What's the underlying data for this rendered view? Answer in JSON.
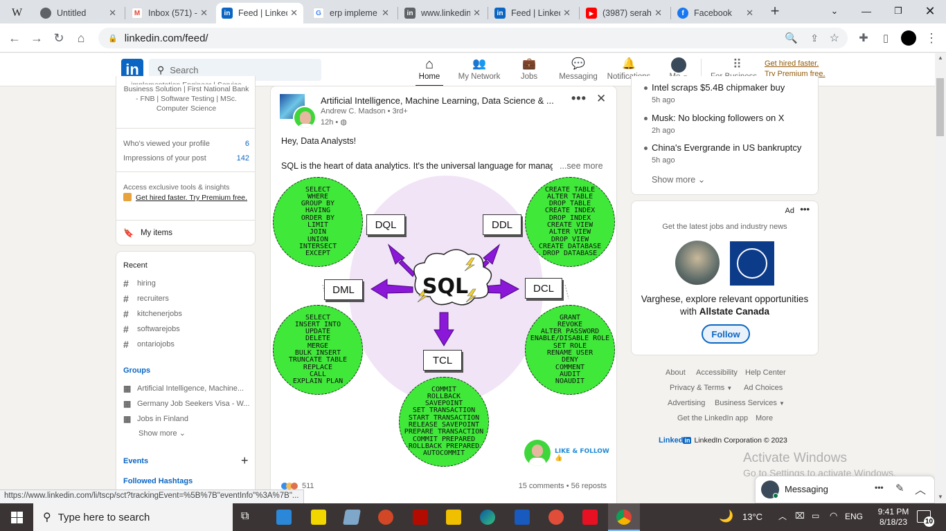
{
  "browser": {
    "tabs": [
      {
        "label": "W",
        "title": "",
        "fav": "W",
        "color": "#ffffff",
        "fgc": "#222"
      },
      {
        "label": "Untitled",
        "title": "Untitled",
        "fav": "◉",
        "color": "#5f6368"
      },
      {
        "label": "Inbox (571) -",
        "title": "Inbox (571) -",
        "fav": "M",
        "color": "#ea4335"
      },
      {
        "label": "Feed | Linked",
        "title": "Feed | Linked",
        "fav": "in",
        "color": "#0a66c2"
      },
      {
        "label": "erp impleme",
        "title": "erp impleme",
        "fav": "G",
        "color": "#4285f4"
      },
      {
        "label": "www.linkedin",
        "title": "www.linkedin",
        "fav": "in",
        "color": "#0a66c2"
      },
      {
        "label": "Feed | Linked",
        "title": "Feed | Linked",
        "fav": "in",
        "color": "#0a66c2"
      },
      {
        "label": "(3987) serah",
        "title": "(3987) serah",
        "fav": "▶",
        "color": "#ff0000"
      },
      {
        "label": "Facebook",
        "title": "Facebook",
        "fav": "f",
        "color": "#1877f2"
      }
    ],
    "url": "linkedin.com/feed/",
    "status_url": "https://www.linkedin.com/li/tscp/sct?trackingEvent=%5B%7B\"eventInfo\"%3A%7B\"..."
  },
  "header": {
    "search_placeholder": "Search",
    "nav": [
      {
        "label": "Home",
        "icon": "home-icon",
        "glyph": "⌂"
      },
      {
        "label": "My Network",
        "icon": "network-icon",
        "glyph": "👥"
      },
      {
        "label": "Jobs",
        "icon": "briefcase-icon",
        "glyph": "💼"
      },
      {
        "label": "Messaging",
        "icon": "messaging-icon",
        "glyph": "💬"
      },
      {
        "label": "Notifications",
        "icon": "bell-icon",
        "glyph": "🔔"
      }
    ],
    "me_label": "Me",
    "for_business": "For Business",
    "premium_line1": "Get hired faster.",
    "premium_line2": "Try Premium free."
  },
  "left": {
    "profile_headline": "Business Solution | First National Bank - FNB | Software Testing | MSc. Computer Science",
    "profile_headline_top": "implementation Engineer | Service",
    "stats": [
      {
        "label": "Who's viewed your profile",
        "value": "6"
      },
      {
        "label": "Impressions of your post",
        "value": "142"
      }
    ],
    "access_text": "Access exclusive tools & insights",
    "premium_text": "Get hired faster. Try Premium free.",
    "my_items": "My items",
    "recent_title": "Recent",
    "recent": [
      "hiring",
      "recruiters",
      "kitchenerjobs",
      "softwarejobs",
      "ontariojobs"
    ],
    "groups_title": "Groups",
    "groups": [
      "Artificial Intelligence, Machine...",
      "Germany Job Seekers Visa - W...",
      "Jobs in Finland"
    ],
    "show_more": "Show more",
    "events": "Events",
    "followed_hashtags": "Followed Hashtags"
  },
  "post": {
    "group": "Artificial Intelligence, Machine Learning, Data Science & ...",
    "author": "Andrew C. Madson • 3rd+",
    "time": "12h •",
    "greeting": "Hey, Data Analysts!",
    "body": "SQL is the heart of data analytics. It's the universal language for managi",
    "see_more": "...see more",
    "center_label": "SQL",
    "boxes": {
      "dql": "DQL",
      "ddl": "DDL",
      "dml": "DML",
      "dcl": "DCL",
      "tcl": "TCL"
    },
    "dql_cmds": [
      "SELECT",
      "WHERE",
      "GROUP BY",
      "HAVING",
      "ORDER BY",
      "LIMIT",
      "JOIN",
      "UNION",
      "INTERSECT",
      "EXCEPT"
    ],
    "ddl_cmds": [
      "CREATE TABLE",
      "ALTER TABLE",
      "DROP TABLE",
      "CREATE INDEX",
      "DROP INDEX",
      "CREATE VIEW",
      "ALTER VIEW",
      "DROP VIEW",
      "CREATE DATABASE",
      "DROP DATABASE"
    ],
    "dml_cmds": [
      "SELECT",
      "INSERT INTO",
      "UPDATE",
      "DELETE",
      "MERGE",
      "BULK INSERT",
      "TRUNCATE TABLE",
      "REPLACE",
      "CALL",
      "EXPLAIN PLAN"
    ],
    "dcl_cmds": [
      "GRANT",
      "REVOKE",
      "ALTER PASSWORD",
      "ENABLE/DISABLE ROLE",
      "SET ROLE",
      "RENAME USER",
      "DENY",
      "COMMENT",
      "AUDIT",
      "NOAUDIT"
    ],
    "tcl_cmds": [
      "COMMIT",
      "ROLLBACK",
      "SAVEPOINT",
      "SET TRANSACTION",
      "START TRANSACTION",
      "RELEASE SAVEPOINT",
      "PREPARE TRANSACTION",
      "COMMIT PREPARED",
      "ROLLBACK PREPARED",
      "AUTOCOMMIT"
    ],
    "like_follow": "LIKE & FOLLOW",
    "reactions": "511",
    "comments_reposts": "15 comments • 56 reposts"
  },
  "right": {
    "news": [
      {
        "title": "Intel scraps $5.4B chipmaker buy",
        "ago": "5h ago"
      },
      {
        "title": "Musk: No blocking followers on X",
        "ago": "2h ago"
      },
      {
        "title": "China's Evergrande in US bankruptcy",
        "ago": "5h ago"
      }
    ],
    "show_more": "Show more",
    "ad_label": "Ad",
    "ad_tagline": "Get the latest jobs and industry news",
    "ad_text_1": "Varghese, explore relevant opportunities",
    "ad_text_2": "with",
    "ad_company": "Allstate Canada",
    "follow": "Follow",
    "footer_links": [
      "About",
      "Accessibility",
      "Help Center",
      "Privacy & Terms",
      "Ad Choices",
      "Advertising",
      "Business Services",
      "Get the LinkedIn app",
      "More"
    ],
    "copyright": "LinkedIn Corporation © 2023",
    "linkedin_word": "Linked"
  },
  "messaging": {
    "label": "Messaging"
  },
  "watermark": {
    "line1": "Activate Windows",
    "line2": "Go to Settings to activate Windows."
  },
  "taskbar": {
    "search_placeholder": "Type here to search",
    "temperature": "13°C",
    "language": "ENG",
    "time": "9:41 PM",
    "date": "8/18/23",
    "notif_count": "10"
  },
  "colors": {
    "brand": "#0a66c2",
    "green": "#40e83a",
    "purple": "#8b17d8"
  }
}
